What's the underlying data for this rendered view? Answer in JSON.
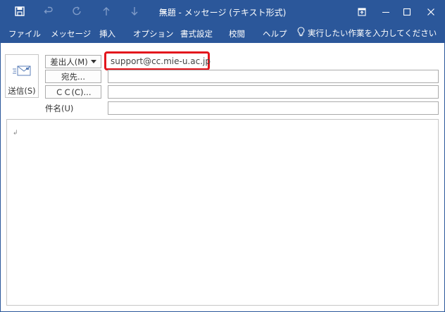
{
  "window": {
    "title": "無題  -  メッセージ (テキスト形式)"
  },
  "ribbon": {
    "tabs": [
      "ファイル",
      "メッセージ",
      "挿入",
      "オプション",
      "書式設定",
      "校閲",
      "ヘルプ"
    ],
    "tell_me": "実行したい作業を入力してください"
  },
  "compose": {
    "send_label": "送信(S)",
    "from_label": "差出人(M)",
    "from_value": "support@cc.mie-u.ac.jp",
    "to_label": "宛先...",
    "cc_label": "ＣＣ(C)...",
    "subject_label": "件名(U)",
    "body_mark": "↲"
  },
  "colors": {
    "accent": "#2b579a",
    "highlight": "#e3161d"
  }
}
